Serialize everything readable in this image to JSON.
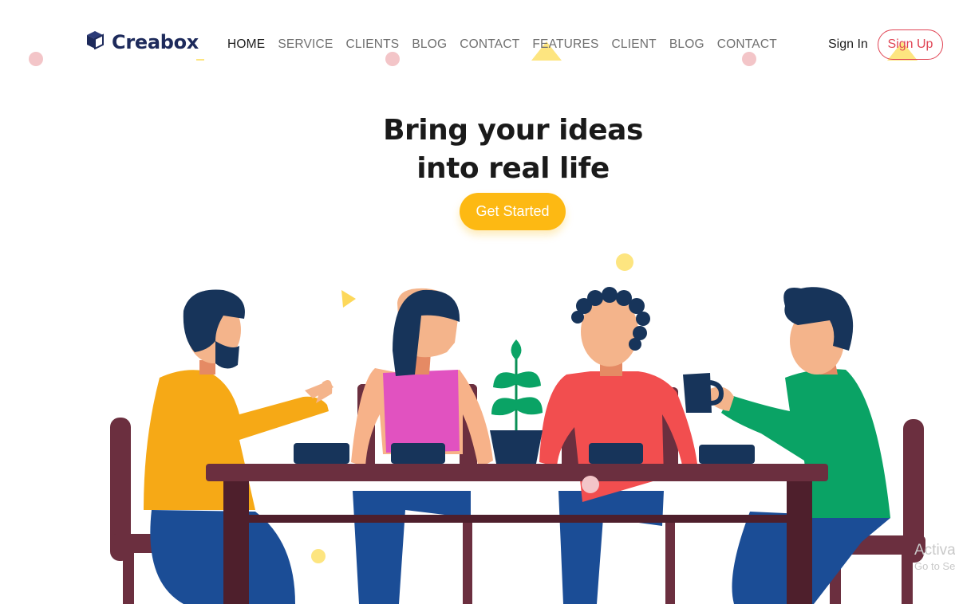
{
  "brand": {
    "name": "Creabox",
    "icon": "cube-icon"
  },
  "nav": {
    "items": [
      {
        "label": "HOME",
        "active": true
      },
      {
        "label": "SERVICE"
      },
      {
        "label": "CLIENTS"
      },
      {
        "label": "BLOG"
      },
      {
        "label": "CONTACT"
      },
      {
        "label": "FEATURES"
      },
      {
        "label": "CLIENT"
      },
      {
        "label": "BLOG"
      },
      {
        "label": "CONTACT"
      }
    ]
  },
  "auth": {
    "sign_in": "Sign In",
    "sign_up": "Sign Up"
  },
  "hero": {
    "title_line1": "Bring your ideas",
    "title_line2": "into real life",
    "cta": "Get Started"
  },
  "watermark": {
    "title": "Activa",
    "subtitle": "Go to Se"
  },
  "colors": {
    "brand": "#1d2a5b",
    "accent": "#fdb913",
    "signup": "#e04454",
    "table": "#6b2f3f"
  }
}
